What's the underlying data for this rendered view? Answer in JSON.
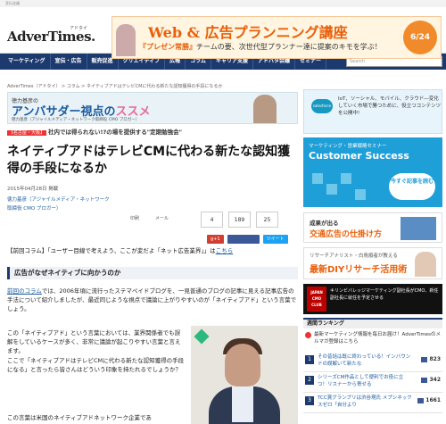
{
  "topbar": {
    "text": "宣伝会議"
  },
  "header": {
    "logo": "AdverTimes.",
    "logo_sub": "アドタイ"
  },
  "top_banner": {
    "title": "Web & 広告プランニング講座",
    "subtitle_highlight": "『プレゼン常勝』",
    "subtitle_rest": "チームの要、次世代型プランナー達に提案のキモを学ぶ！",
    "date": "6/24"
  },
  "nav": {
    "items": [
      "マーケティング",
      "宣伝・広告",
      "販売促進",
      "クリエイティブ",
      "広報",
      "コラム",
      "キャリア支援",
      "アドバタ会議",
      "セミナー"
    ],
    "search_placeholder": "Search"
  },
  "breadcrumb": "AdverTimes（アドタイ） > コラム > ネイティブアドはテレビCMに代わる新たな認知獲得の手段になるか",
  "promo": {
    "small": "徳力基彦の",
    "big": "アンバサダー視点の",
    "big_pink": "ススメ",
    "caption": "徳力基彦（アジャイルメディア・ネットワーク取締役 CMO ブロガー）"
  },
  "tagline": {
    "tag": "【名古屋・大阪】",
    "title": "社内では得られない!?の場を提供する\"定期勉強会\""
  },
  "article": {
    "title": "ネイティブアドはテレビCMに代わる新たな認知獲得の手段になるか",
    "date": "2015年04月28日 掲載",
    "author": "徳力基彦（アジャイルメディア・ネットワーク",
    "author_role": "取締役 CMO ブロガー）",
    "share_counts": {
      "b": "4",
      "like": "189",
      "tw": "25"
    },
    "share_labels": {
      "print": "印刷",
      "email": "メール",
      "g": "g+1",
      "tweet": "ツイート"
    },
    "column_note_prefix": "【前回コラム】「ユーザー目線で考えよう、ここが変だよ「ネット広告業界」」は",
    "column_note_link": "こちら",
    "section_heading": "広告がなぜネイティブに向かうのか",
    "para1_link": "前回のコラム",
    "para1": "では、2006年頃に流行ったステマペイドブログを、一見普通のブログの記事に見える記事広告の手法について紹介しましたが、最近同じような視点で議論に上がりやすいのが「ネイティブアド」という言葉でしょう。",
    "para2": "この「ネイティブアド」という言葉においては、業界関係者でも誤解をしているケースが多く、非常に議論が起こりやすい言葉と言えます。",
    "para3": "ここで「ネイティブアドはテレビCMに代わる新たな認知獲得の手段になる」と言ったら皆さんはどういう印象を持たれるでしょうか？",
    "para4": "この言葉は米国のネイティブアドネットワーク企業であ"
  },
  "sidebar": {
    "ad1": {
      "brand": "salesforce",
      "text": "IoT、ソーシャル、モバイル、クラウド―変化していく市場で勝つために、役立つコンテンツを公開中!"
    },
    "ad2": {
      "small": "マーケティング・営業戦略セミナー",
      "big": "Customer Success",
      "cta": "今すぐ記事を読む"
    },
    "ad3": {
      "small": "成果が出る",
      "big": "交通広告の仕掛け方"
    },
    "ad4": {
      "small": "リサーチアナリスト・白鳥順者が教える",
      "big": "最新DIYリサーチ活用術"
    },
    "ad5": {
      "badge": "JAPAN CMO CLUB",
      "text": "キリンビバレッジマーケティング副社長がCMO、新任副社長に就任を予定させる"
    },
    "ranking_title": "週間ランキング",
    "ranking_alert": "最新マーケティング情報を毎日お届け！AdverTimesのメルマガ登録はこちら",
    "ranking": [
      {
        "num": "1",
        "text": "その昔話は既に終わっている！インバウンドの誤解いて新たな",
        "count": "823"
      },
      {
        "num": "2",
        "text": "シリーズCM作品として便利でお役に立つ！リスナーから寄せる",
        "count": "342"
      },
      {
        "num": "3",
        "text": "TCC賞グランプリは渋谷現氏 メプシネックスゼロ「自分より",
        "count": "1661"
      }
    ]
  }
}
